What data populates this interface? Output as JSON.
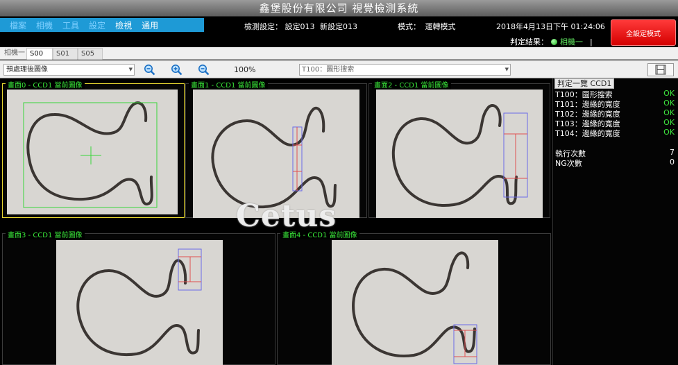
{
  "title": "鑫堡股份有限公司 視覺檢測系統",
  "menu": [
    {
      "label": "檔案",
      "active": false
    },
    {
      "label": "相機",
      "active": false
    },
    {
      "label": "工具",
      "active": false
    },
    {
      "label": "設定",
      "active": false
    },
    {
      "label": "檢視",
      "active": true
    },
    {
      "label": "通用",
      "active": true
    }
  ],
  "status": {
    "detect_label": "檢測設定：",
    "detect_value": "設定013",
    "new_setting": "新設定013",
    "mode_label": "模式：",
    "mode_value": "運轉模式",
    "datetime": "2018年4月13日下午 01:24:06",
    "judge_label": "判定結果：",
    "judge_value": "相機一",
    "judge_tail": "|"
  },
  "set_mode_button": "全設定模式",
  "camera_tab": "相機一",
  "tabs": [
    "S00",
    "S01",
    "S05"
  ],
  "toolbar": {
    "image_select": "預處理後圖像",
    "zoom_level": "100%",
    "tool_select": "T100：圖形搜索"
  },
  "panels": [
    {
      "title": "畫面0 - CCD1 當前圖像"
    },
    {
      "title": "畫面1 - CCD1 當前圖像"
    },
    {
      "title": "畫面2 - CCD1 當前圖像"
    },
    {
      "title": "畫面3 - CCD1 當前圖像"
    },
    {
      "title": "畫面4 - CCD1 當前圖像"
    }
  ],
  "results": {
    "title": "判定一覽 CCD1",
    "items": [
      {
        "name": "T100：圖形搜索",
        "result": "OK"
      },
      {
        "name": "T101：邊緣的寬度",
        "result": "OK"
      },
      {
        "name": "T102：邊緣的寬度",
        "result": "OK"
      },
      {
        "name": "T103：邊緣的寬度",
        "result": "OK"
      },
      {
        "name": "T104：邊緣的寬度",
        "result": "OK"
      }
    ],
    "exec_label": "執行次數",
    "exec_count": "7",
    "ng_label": "NG次數",
    "ng_count": "0"
  },
  "watermark": "Cetus",
  "colors": {
    "accent": "#1e9ad6",
    "ok": "#3ee63e",
    "alarm": "#e00000",
    "panel_title": "#39e639"
  }
}
